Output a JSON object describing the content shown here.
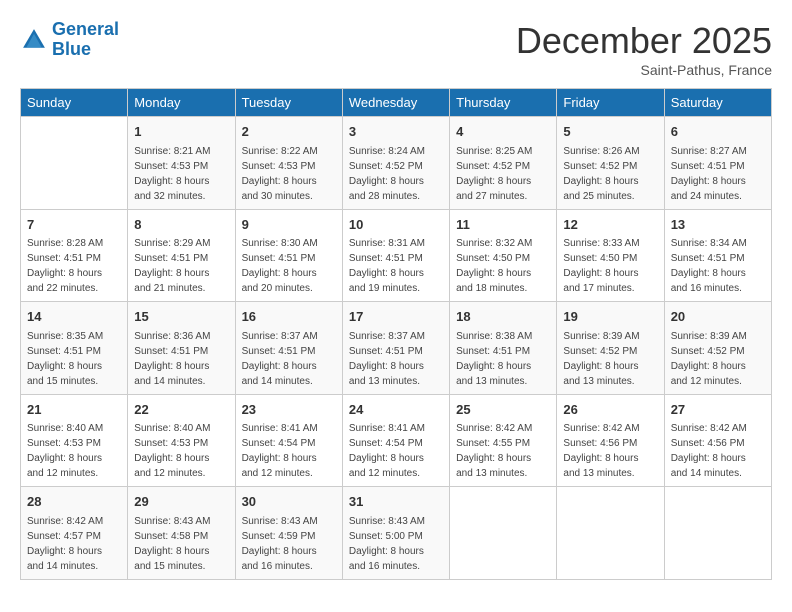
{
  "header": {
    "logo_line1": "General",
    "logo_line2": "Blue",
    "month_title": "December 2025",
    "location": "Saint-Pathus, France"
  },
  "days_of_week": [
    "Sunday",
    "Monday",
    "Tuesday",
    "Wednesday",
    "Thursday",
    "Friday",
    "Saturday"
  ],
  "weeks": [
    [
      {
        "day": "",
        "sunrise": "",
        "sunset": "",
        "daylight": ""
      },
      {
        "day": "1",
        "sunrise": "Sunrise: 8:21 AM",
        "sunset": "Sunset: 4:53 PM",
        "daylight": "Daylight: 8 hours and 32 minutes."
      },
      {
        "day": "2",
        "sunrise": "Sunrise: 8:22 AM",
        "sunset": "Sunset: 4:53 PM",
        "daylight": "Daylight: 8 hours and 30 minutes."
      },
      {
        "day": "3",
        "sunrise": "Sunrise: 8:24 AM",
        "sunset": "Sunset: 4:52 PM",
        "daylight": "Daylight: 8 hours and 28 minutes."
      },
      {
        "day": "4",
        "sunrise": "Sunrise: 8:25 AM",
        "sunset": "Sunset: 4:52 PM",
        "daylight": "Daylight: 8 hours and 27 minutes."
      },
      {
        "day": "5",
        "sunrise": "Sunrise: 8:26 AM",
        "sunset": "Sunset: 4:52 PM",
        "daylight": "Daylight: 8 hours and 25 minutes."
      },
      {
        "day": "6",
        "sunrise": "Sunrise: 8:27 AM",
        "sunset": "Sunset: 4:51 PM",
        "daylight": "Daylight: 8 hours and 24 minutes."
      }
    ],
    [
      {
        "day": "7",
        "sunrise": "Sunrise: 8:28 AM",
        "sunset": "Sunset: 4:51 PM",
        "daylight": "Daylight: 8 hours and 22 minutes."
      },
      {
        "day": "8",
        "sunrise": "Sunrise: 8:29 AM",
        "sunset": "Sunset: 4:51 PM",
        "daylight": "Daylight: 8 hours and 21 minutes."
      },
      {
        "day": "9",
        "sunrise": "Sunrise: 8:30 AM",
        "sunset": "Sunset: 4:51 PM",
        "daylight": "Daylight: 8 hours and 20 minutes."
      },
      {
        "day": "10",
        "sunrise": "Sunrise: 8:31 AM",
        "sunset": "Sunset: 4:51 PM",
        "daylight": "Daylight: 8 hours and 19 minutes."
      },
      {
        "day": "11",
        "sunrise": "Sunrise: 8:32 AM",
        "sunset": "Sunset: 4:50 PM",
        "daylight": "Daylight: 8 hours and 18 minutes."
      },
      {
        "day": "12",
        "sunrise": "Sunrise: 8:33 AM",
        "sunset": "Sunset: 4:50 PM",
        "daylight": "Daylight: 8 hours and 17 minutes."
      },
      {
        "day": "13",
        "sunrise": "Sunrise: 8:34 AM",
        "sunset": "Sunset: 4:51 PM",
        "daylight": "Daylight: 8 hours and 16 minutes."
      }
    ],
    [
      {
        "day": "14",
        "sunrise": "Sunrise: 8:35 AM",
        "sunset": "Sunset: 4:51 PM",
        "daylight": "Daylight: 8 hours and 15 minutes."
      },
      {
        "day": "15",
        "sunrise": "Sunrise: 8:36 AM",
        "sunset": "Sunset: 4:51 PM",
        "daylight": "Daylight: 8 hours and 14 minutes."
      },
      {
        "day": "16",
        "sunrise": "Sunrise: 8:37 AM",
        "sunset": "Sunset: 4:51 PM",
        "daylight": "Daylight: 8 hours and 14 minutes."
      },
      {
        "day": "17",
        "sunrise": "Sunrise: 8:37 AM",
        "sunset": "Sunset: 4:51 PM",
        "daylight": "Daylight: 8 hours and 13 minutes."
      },
      {
        "day": "18",
        "sunrise": "Sunrise: 8:38 AM",
        "sunset": "Sunset: 4:51 PM",
        "daylight": "Daylight: 8 hours and 13 minutes."
      },
      {
        "day": "19",
        "sunrise": "Sunrise: 8:39 AM",
        "sunset": "Sunset: 4:52 PM",
        "daylight": "Daylight: 8 hours and 13 minutes."
      },
      {
        "day": "20",
        "sunrise": "Sunrise: 8:39 AM",
        "sunset": "Sunset: 4:52 PM",
        "daylight": "Daylight: 8 hours and 12 minutes."
      }
    ],
    [
      {
        "day": "21",
        "sunrise": "Sunrise: 8:40 AM",
        "sunset": "Sunset: 4:53 PM",
        "daylight": "Daylight: 8 hours and 12 minutes."
      },
      {
        "day": "22",
        "sunrise": "Sunrise: 8:40 AM",
        "sunset": "Sunset: 4:53 PM",
        "daylight": "Daylight: 8 hours and 12 minutes."
      },
      {
        "day": "23",
        "sunrise": "Sunrise: 8:41 AM",
        "sunset": "Sunset: 4:54 PM",
        "daylight": "Daylight: 8 hours and 12 minutes."
      },
      {
        "day": "24",
        "sunrise": "Sunrise: 8:41 AM",
        "sunset": "Sunset: 4:54 PM",
        "daylight": "Daylight: 8 hours and 12 minutes."
      },
      {
        "day": "25",
        "sunrise": "Sunrise: 8:42 AM",
        "sunset": "Sunset: 4:55 PM",
        "daylight": "Daylight: 8 hours and 13 minutes."
      },
      {
        "day": "26",
        "sunrise": "Sunrise: 8:42 AM",
        "sunset": "Sunset: 4:56 PM",
        "daylight": "Daylight: 8 hours and 13 minutes."
      },
      {
        "day": "27",
        "sunrise": "Sunrise: 8:42 AM",
        "sunset": "Sunset: 4:56 PM",
        "daylight": "Daylight: 8 hours and 14 minutes."
      }
    ],
    [
      {
        "day": "28",
        "sunrise": "Sunrise: 8:42 AM",
        "sunset": "Sunset: 4:57 PM",
        "daylight": "Daylight: 8 hours and 14 minutes."
      },
      {
        "day": "29",
        "sunrise": "Sunrise: 8:43 AM",
        "sunset": "Sunset: 4:58 PM",
        "daylight": "Daylight: 8 hours and 15 minutes."
      },
      {
        "day": "30",
        "sunrise": "Sunrise: 8:43 AM",
        "sunset": "Sunset: 4:59 PM",
        "daylight": "Daylight: 8 hours and 16 minutes."
      },
      {
        "day": "31",
        "sunrise": "Sunrise: 8:43 AM",
        "sunset": "Sunset: 5:00 PM",
        "daylight": "Daylight: 8 hours and 16 minutes."
      },
      {
        "day": "",
        "sunrise": "",
        "sunset": "",
        "daylight": ""
      },
      {
        "day": "",
        "sunrise": "",
        "sunset": "",
        "daylight": ""
      },
      {
        "day": "",
        "sunrise": "",
        "sunset": "",
        "daylight": ""
      }
    ]
  ]
}
